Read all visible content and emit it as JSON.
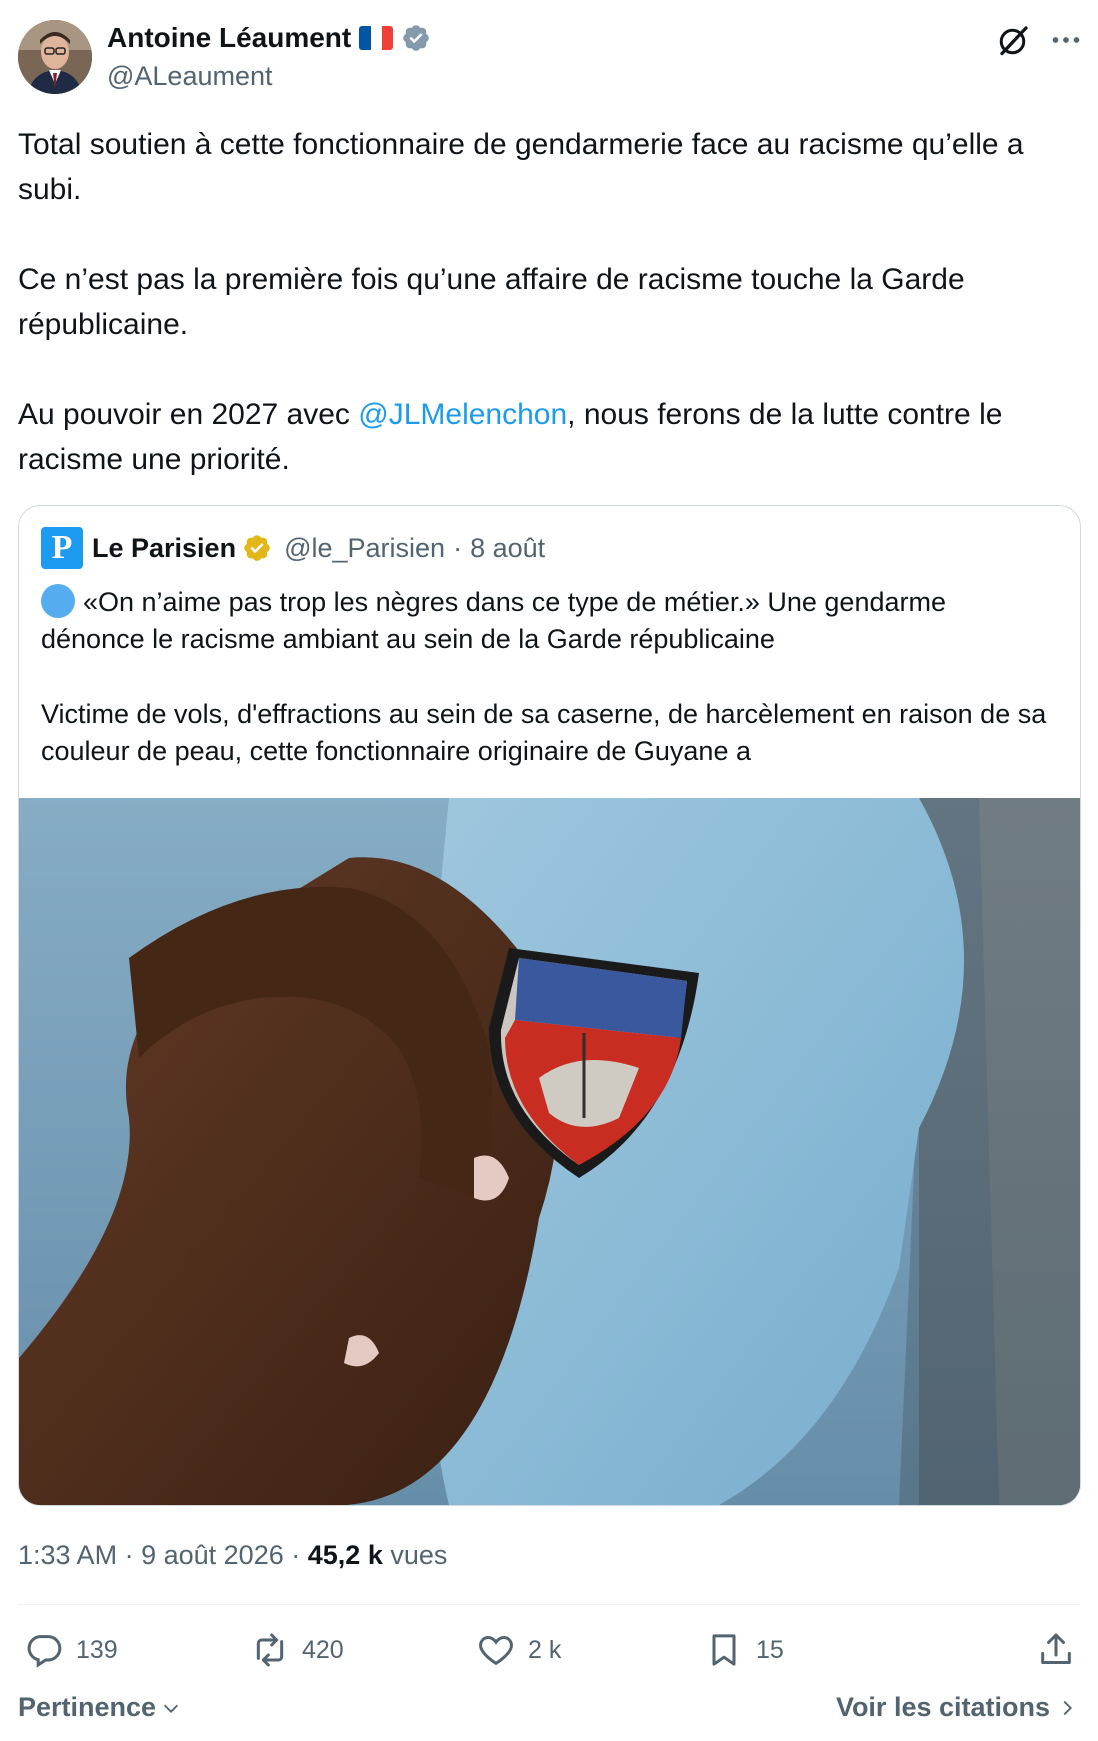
{
  "author": {
    "name": "Antoine Léaument",
    "handle": "@ALeaument"
  },
  "tweet": {
    "paragraph1": "Total soutien à cette fonctionnaire de gendarmerie face au racisme qu’elle a subi.",
    "paragraph2": "Ce n’est pas la première fois qu’une affaire de racisme touche la Garde républicaine.",
    "paragraph3_before": "Au pouvoir en 2027 avec ",
    "mention": "@JLMelenchon",
    "paragraph3_after": ", nous ferons de la lutte contre le racisme une priorité."
  },
  "quote": {
    "logo_letter": "P",
    "name": "Le Parisien",
    "handle": "@le_Parisien",
    "separator": "·",
    "date": "8 août",
    "text1": "«On n’aime pas trop les nègres dans ce type de métier.» Une gendarme dénonce le racisme ambiant au sein de la Garde républicaine",
    "text2": "Victime de vols, d'effractions au sein de sa caserne, de harcèlement en raison de sa couleur de peau, cette fonctionnaire originaire de Guyane a"
  },
  "meta": {
    "time": "1:33 AM",
    "sep1": "·",
    "date": "9 août 2026",
    "sep2": "·",
    "views_count": "45,2 k",
    "views_label": "vues"
  },
  "actions": {
    "replies": "139",
    "reposts": "420",
    "likes": "2 k",
    "bookmarks": "15"
  },
  "footer": {
    "sort_label": "Pertinence",
    "quotes_label": "Voir les citations"
  },
  "colors": {
    "link": "#1d9bf0",
    "secondary": "#536471",
    "verified_blue": "#1d9bf0",
    "verified_gold": "#e2b719"
  }
}
